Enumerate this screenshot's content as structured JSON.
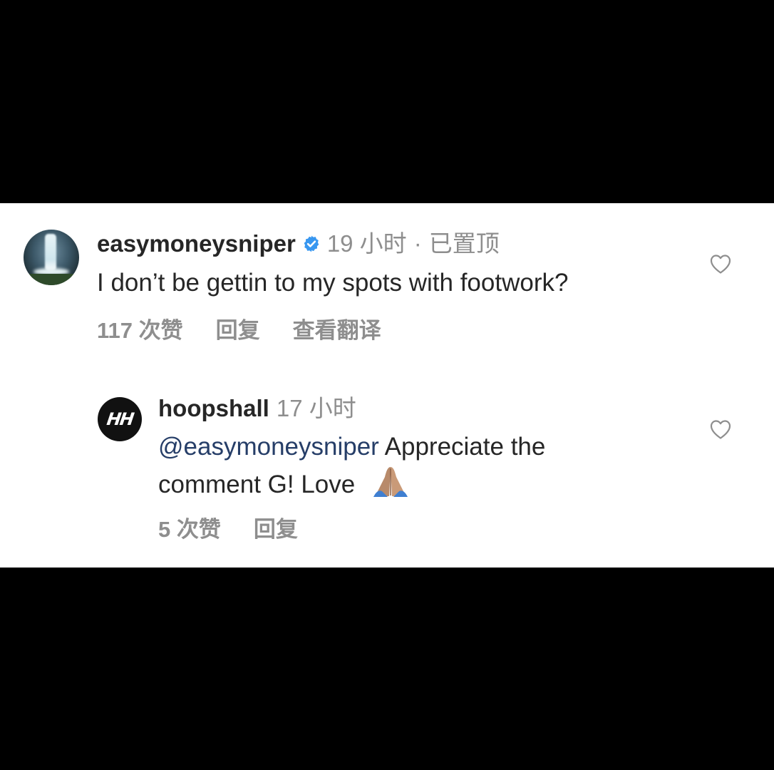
{
  "comments": [
    {
      "username": "easymoneysniper",
      "verified": true,
      "time": "19 小时",
      "separator": "·",
      "pinned": "已置顶",
      "text": "I don’t be gettin to my spots with footwork?",
      "likes": "117 次赞",
      "reply": "回复",
      "translate": "查看翻译",
      "avatar_icon": "waterfall-photo"
    },
    {
      "username": "hoopshall",
      "verified": false,
      "time": "17 小时",
      "mention": "@easymoneysniper",
      "text_line1": " Appreciate the",
      "text_line2": "comment G! Love",
      "emoji": "🙏🏽",
      "likes": "5 次赞",
      "reply": "回复",
      "avatar_text": "HH"
    }
  ],
  "colors": {
    "background": "#000000",
    "panel": "#ffffff",
    "text": "#262626",
    "secondary": "#8e8e8e",
    "mention": "#263e68",
    "verified": "#3897f0"
  }
}
